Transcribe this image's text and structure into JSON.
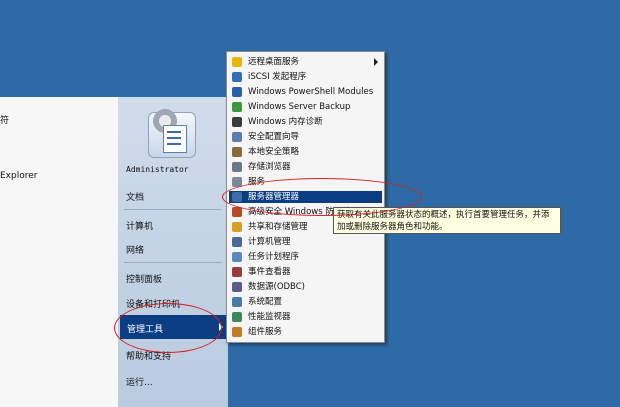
{
  "left_pane": {
    "items": [
      "符",
      "Explorer"
    ]
  },
  "right_pane": {
    "items": [
      "Administrator",
      "文档",
      "计算机",
      "网络",
      "控制面板",
      "设备和打印机",
      "管理工具",
      "帮助和支持",
      "运行..."
    ],
    "highlighted": "管理工具"
  },
  "submenu": {
    "items": [
      {
        "label": "远程桌面服务",
        "icon": "folder-icon",
        "has_submenu": true,
        "color": "#e6b800"
      },
      {
        "label": "iSCSI 发起程序",
        "icon": "globe-icon",
        "has_submenu": false,
        "color": "#2f6fb8"
      },
      {
        "label": "Windows PowerShell Modules",
        "icon": "powershell-icon",
        "has_submenu": false,
        "color": "#2a5fa8"
      },
      {
        "label": "Windows Server Backup",
        "icon": "backup-icon",
        "has_submenu": false,
        "color": "#3c9a3c"
      },
      {
        "label": "Windows 内存诊断",
        "icon": "memory-icon",
        "has_submenu": false,
        "color": "#3a3a3a"
      },
      {
        "label": "安全配置向导",
        "icon": "security-wizard-icon",
        "has_submenu": false,
        "color": "#5a7db0"
      },
      {
        "label": "本地安全策略",
        "icon": "policy-icon",
        "has_submenu": false,
        "color": "#8a6a3a"
      },
      {
        "label": "存储浏览器",
        "icon": "storage-icon",
        "has_submenu": false,
        "color": "#6a7a8a"
      },
      {
        "label": "服务",
        "icon": "services-icon",
        "has_submenu": false,
        "color": "#7a8a9a"
      },
      {
        "label": "服务器管理器",
        "icon": "server-manager-icon",
        "has_submenu": false,
        "color": "#3a6ea5",
        "selected": true
      },
      {
        "label": "高级安全 Windows 防火墙",
        "icon": "firewall-icon",
        "has_submenu": false,
        "color": "#b84a2a"
      },
      {
        "label": "共享和存储管理",
        "icon": "share-icon",
        "has_submenu": false,
        "color": "#d8a020"
      },
      {
        "label": "计算机管理",
        "icon": "computer-management-icon",
        "has_submenu": false,
        "color": "#4a6a9a"
      },
      {
        "label": "任务计划程序",
        "icon": "scheduler-icon",
        "has_submenu": false,
        "color": "#5a8ac0"
      },
      {
        "label": "事件查看器",
        "icon": "event-viewer-icon",
        "has_submenu": false,
        "color": "#9a3a3a"
      },
      {
        "label": "数据源(ODBC)",
        "icon": "odbc-icon",
        "has_submenu": false,
        "color": "#5a5a8a"
      },
      {
        "label": "系统配置",
        "icon": "system-config-icon",
        "has_submenu": false,
        "color": "#4a7aaa"
      },
      {
        "label": "性能监视器",
        "icon": "performance-icon",
        "has_submenu": false,
        "color": "#3a8a5a"
      },
      {
        "label": "组件服务",
        "icon": "component-services-icon",
        "has_submenu": false,
        "color": "#c07a20"
      }
    ]
  },
  "tooltip": {
    "text": "获取有关此服务器状态的概述，执行首要管理任务，并添加或删除服务器角色和功能。"
  },
  "colors": {
    "desktop": "#2d6aa6",
    "highlight": "#0b3d82",
    "annotation": "#d62020"
  }
}
